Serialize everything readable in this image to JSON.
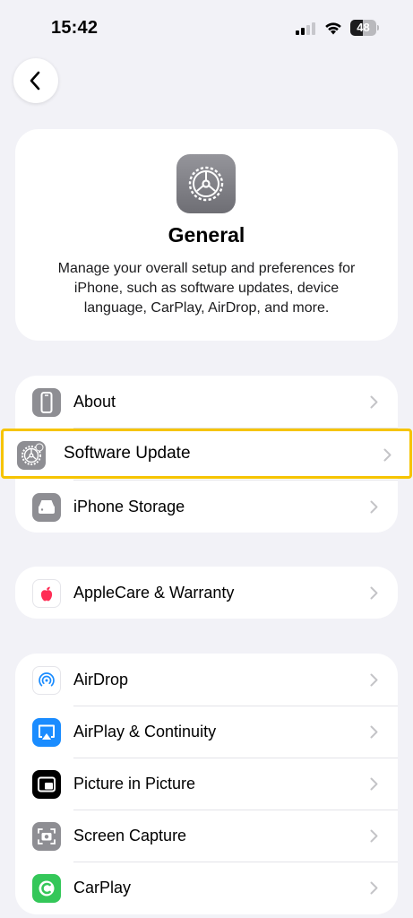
{
  "status_bar": {
    "time": "15:42",
    "battery_level": "48",
    "battery_fraction": 0.48
  },
  "nav": {
    "back_icon": "chevron-left-icon"
  },
  "header": {
    "icon": "gear-icon",
    "title": "General",
    "description": "Manage your overall setup and preferences for iPhone, such as software updates, device language, CarPlay, AirDrop, and more."
  },
  "groups": [
    {
      "rows": [
        {
          "label": "About",
          "icon": "phone-info-icon",
          "color": "#8e8e93"
        },
        {
          "label": "Software Update",
          "icon": "gear-icon",
          "color": "#8e8e93",
          "highlighted": true,
          "highlight_color": "#f6c400"
        },
        {
          "label": "iPhone Storage",
          "icon": "storage-icon",
          "color": "#8e8e93"
        }
      ]
    },
    {
      "rows": [
        {
          "label": "AppleCare & Warranty",
          "icon": "apple-logo-icon",
          "color": "#ff3b30"
        }
      ]
    },
    {
      "rows": [
        {
          "label": "AirDrop",
          "icon": "airdrop-icon",
          "color": "#1a8cff"
        },
        {
          "label": "AirPlay & Continuity",
          "icon": "airplay-icon",
          "color": "#1a8cff"
        },
        {
          "label": "Picture in Picture",
          "icon": "picture-in-picture-icon",
          "color": "#000000"
        },
        {
          "label": "Screen Capture",
          "icon": "camera-viewfinder-icon",
          "color": "#8e8e93"
        },
        {
          "label": "CarPlay",
          "icon": "carplay-icon",
          "color": "#34c759"
        }
      ]
    }
  ]
}
